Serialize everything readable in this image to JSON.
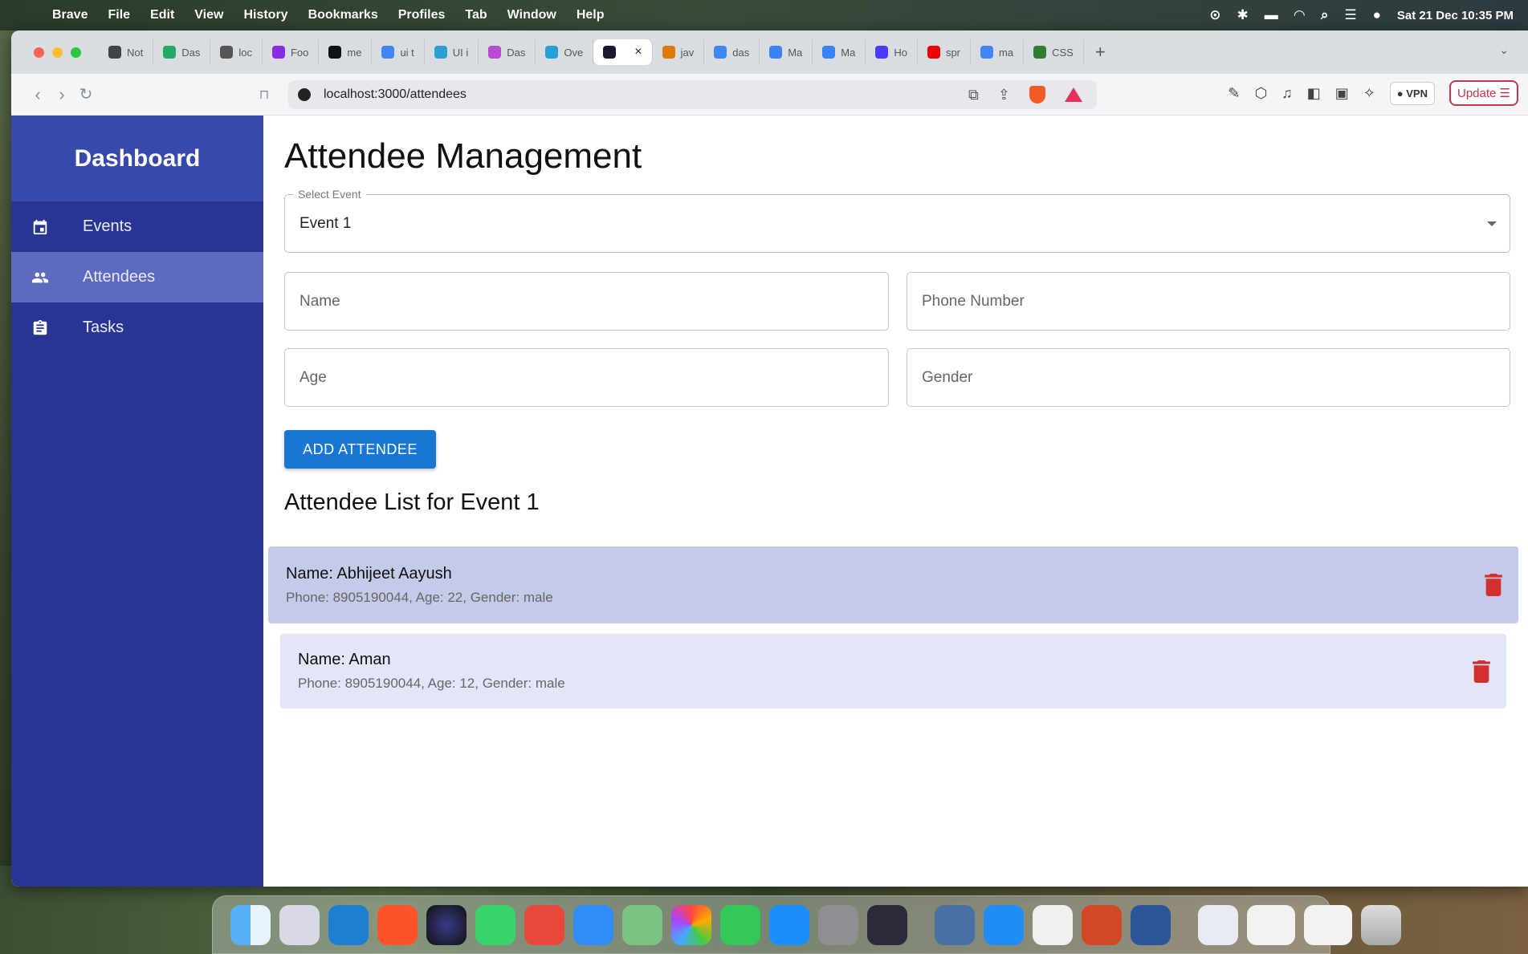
{
  "menubar": {
    "app": "Brave",
    "items": [
      "File",
      "Edit",
      "View",
      "History",
      "Bookmarks",
      "Profiles",
      "Tab",
      "Window",
      "Help"
    ],
    "clock": "Sat 21 Dec  10:35 PM"
  },
  "browser": {
    "tabs": [
      {
        "label": "Not",
        "icon": "notion-icon",
        "color": "#444"
      },
      {
        "label": "Das",
        "icon": "dashboard-icon",
        "color": "#2a6"
      },
      {
        "label": "loc",
        "icon": "globe-icon",
        "color": "#555"
      },
      {
        "label": "Foo",
        "icon": "vercel-icon",
        "color": "#8a2be2"
      },
      {
        "label": "me",
        "icon": "github-icon",
        "color": "#111"
      },
      {
        "label": "ui t",
        "icon": "google-icon",
        "color": "#4285f4"
      },
      {
        "label": "UI i",
        "icon": "ui-icon",
        "color": "#2a9fd6"
      },
      {
        "label": "Das",
        "icon": "dash-icon",
        "color": "#b84bd1"
      },
      {
        "label": "Ove",
        "icon": "overview-icon",
        "color": "#2a9fd6"
      },
      {
        "label": "",
        "icon": "react-icon",
        "color": "#1a1a2e",
        "active": true
      },
      {
        "label": "jav",
        "icon": "java-icon",
        "color": "#e07b00"
      },
      {
        "label": "das",
        "icon": "google-icon",
        "color": "#4285f4"
      },
      {
        "label": "Ma",
        "icon": "material-icon",
        "color": "#3b82f6"
      },
      {
        "label": "Ma",
        "icon": "material-icon",
        "color": "#3b82f6"
      },
      {
        "label": "Ho",
        "icon": "home-icon",
        "color": "#4a3aff"
      },
      {
        "label": "spr",
        "icon": "youtube-icon",
        "color": "#e00"
      },
      {
        "label": "ma",
        "icon": "google-icon",
        "color": "#4285f4"
      },
      {
        "label": "CSS",
        "icon": "w3-icon",
        "color": "#2e7d32"
      }
    ],
    "url": "localhost:3000/attendees",
    "vpn_label": "VPN",
    "update_label": "Update"
  },
  "sidebar": {
    "title": "Dashboard",
    "items": [
      {
        "label": "Events",
        "icon": "calendar-icon"
      },
      {
        "label": "Attendees",
        "icon": "people-icon",
        "active": true
      },
      {
        "label": "Tasks",
        "icon": "clipboard-icon"
      }
    ]
  },
  "main": {
    "title": "Attendee Management",
    "select": {
      "label": "Select Event",
      "value": "Event 1"
    },
    "fields": {
      "name": "Name",
      "phone": "Phone Number",
      "age": "Age",
      "gender": "Gender"
    },
    "add_button": "ADD ATTENDEE",
    "list_title": "Attendee List for Event 1",
    "attendees": [
      {
        "name": "Name: Abhijeet Aayush",
        "details": "Phone: 8905190044, Age: 22, Gender: male"
      },
      {
        "name": "Name: Aman",
        "details": "Phone: 8905190044, Age: 12, Gender: male"
      }
    ]
  },
  "colors": {
    "sidebar": "#283593",
    "sidebar_header": "#3949ab",
    "sidebar_active": "#5c6bc0",
    "primary": "#1976d2",
    "delete": "#d32f2f",
    "row_hover": "#c5cae9",
    "row": "#e3e6f8"
  }
}
